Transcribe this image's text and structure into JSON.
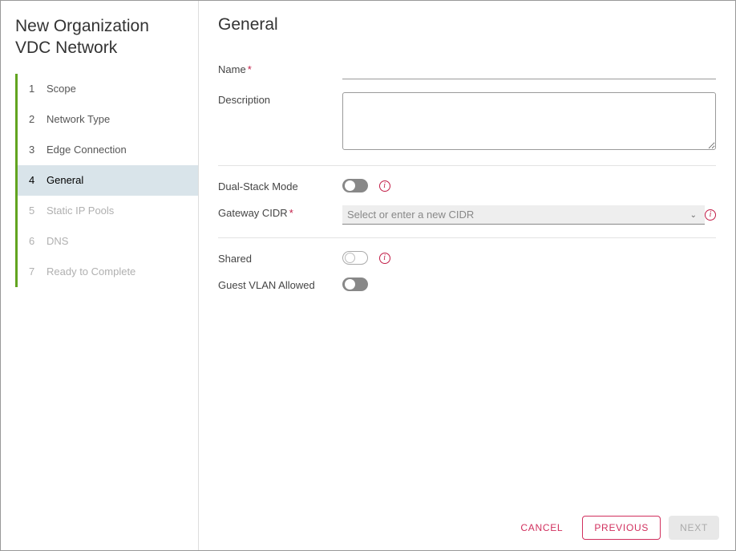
{
  "dialogTitle": "New Organization VDC Network",
  "steps": [
    {
      "num": "1",
      "label": "Scope",
      "state": "done"
    },
    {
      "num": "2",
      "label": "Network Type",
      "state": "done"
    },
    {
      "num": "3",
      "label": "Edge Connection",
      "state": "done"
    },
    {
      "num": "4",
      "label": "General",
      "state": "active"
    },
    {
      "num": "5",
      "label": "Static IP Pools",
      "state": "disabled"
    },
    {
      "num": "6",
      "label": "DNS",
      "state": "disabled"
    },
    {
      "num": "7",
      "label": "Ready to Complete",
      "state": "disabled"
    }
  ],
  "pageHeading": "General",
  "fields": {
    "name": {
      "label": "Name",
      "required": true,
      "value": ""
    },
    "description": {
      "label": "Description",
      "value": ""
    },
    "dualStack": {
      "label": "Dual-Stack Mode",
      "on": false,
      "info": true
    },
    "gatewayCidr": {
      "label": "Gateway CIDR",
      "required": true,
      "placeholder": "Select or enter a new CIDR",
      "info": true
    },
    "shared": {
      "label": "Shared",
      "on": false,
      "info": true
    },
    "guestVlan": {
      "label": "Guest VLAN Allowed",
      "on": false
    }
  },
  "buttons": {
    "cancel": "CANCEL",
    "previous": "PREVIOUS",
    "next": "NEXT"
  }
}
